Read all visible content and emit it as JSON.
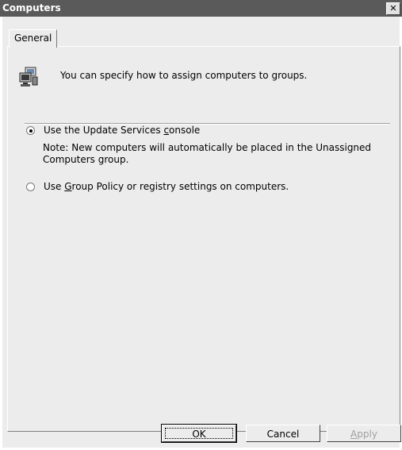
{
  "window": {
    "title": "Computers",
    "close_label": "✕"
  },
  "tabs": [
    {
      "label": "General"
    }
  ],
  "info": {
    "icon": "computers-icon",
    "text": "You can specify how to assign computers to groups."
  },
  "options": {
    "console": {
      "label_pre": "Use the Update Services ",
      "label_accel": "c",
      "label_post": "onsole",
      "selected": true
    },
    "note": "Note: New computers will automatically be placed in the Unassigned Computers group.",
    "group_policy": {
      "label_pre": "Use ",
      "label_accel": "G",
      "label_post": "roup Policy or registry settings on computers.",
      "selected": false
    }
  },
  "buttons": {
    "ok": "OK",
    "cancel": "Cancel",
    "apply_accel": "A",
    "apply_rest": "pply"
  }
}
